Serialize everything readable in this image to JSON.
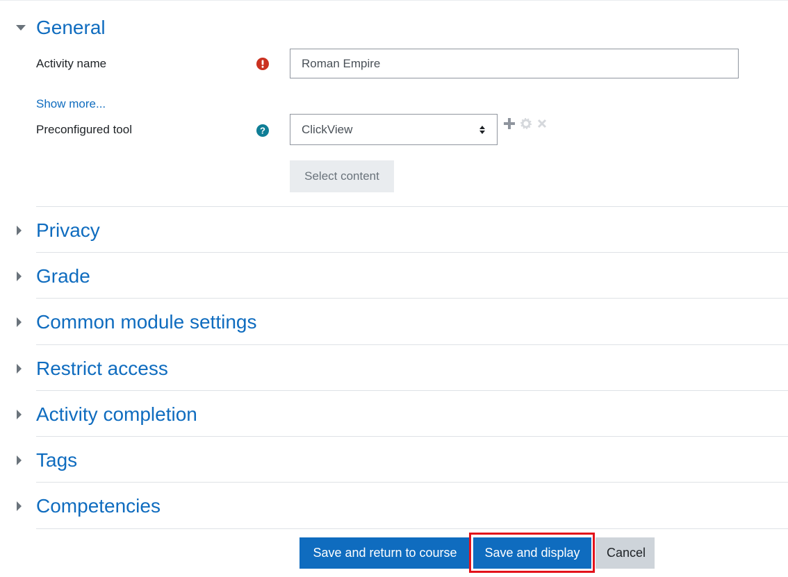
{
  "general": {
    "title": "General",
    "activity_name_label": "Activity name",
    "activity_name_value": "Roman Empire",
    "show_more": "Show more...",
    "preconfigured_tool_label": "Preconfigured tool",
    "preconfigured_tool_value": "ClickView",
    "select_content_label": "Select content"
  },
  "sections": [
    {
      "title": "Privacy"
    },
    {
      "title": "Grade"
    },
    {
      "title": "Common module settings"
    },
    {
      "title": "Restrict access"
    },
    {
      "title": "Activity completion"
    },
    {
      "title": "Tags"
    },
    {
      "title": "Competencies"
    }
  ],
  "buttons": {
    "save_return": "Save and return to course",
    "save_display": "Save and display",
    "cancel": "Cancel"
  },
  "colors": {
    "link": "#0f6cbf",
    "primary": "#0f6cbf",
    "required": "#ca3120",
    "help": "#0f7e96",
    "highlight": "#e3121b"
  },
  "icons": {
    "expanded": "caret-down-icon",
    "collapsed": "caret-right-icon",
    "required": "exclamation-circle-icon",
    "help": "question-circle-icon",
    "add": "plus-icon",
    "edit": "cog-icon",
    "delete": "times-icon"
  }
}
